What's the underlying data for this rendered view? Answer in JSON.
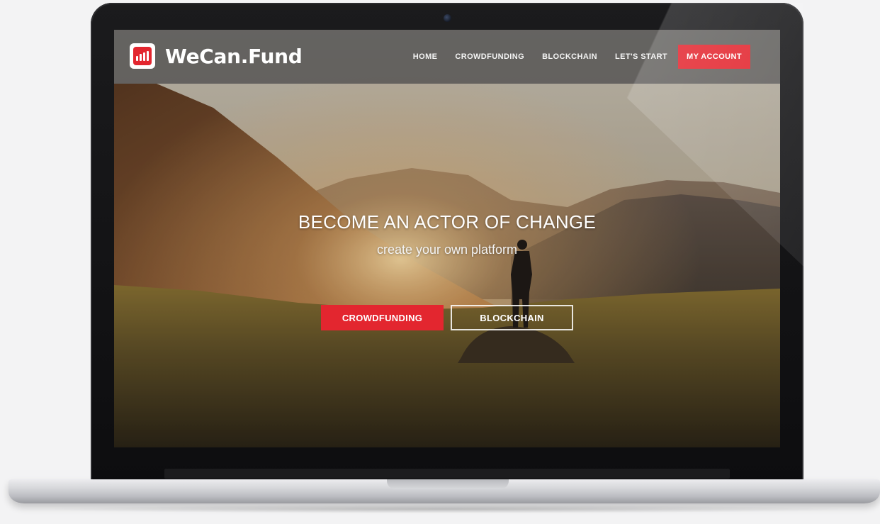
{
  "brand": {
    "name": "WeCan.Fund",
    "accent_color": "#e3262f",
    "logo_icon": "bar-chart-icon"
  },
  "nav": {
    "items": [
      {
        "label": "HOME"
      },
      {
        "label": "CROWDFUNDING"
      },
      {
        "label": "BLOCKCHAIN"
      },
      {
        "label": "LET'S START"
      }
    ],
    "account_label": "MY ACCOUNT"
  },
  "hero": {
    "title": "BECOME AN ACTOR OF CHANGE",
    "subtitle": "create your own platform",
    "primary_button": "CROWDFUNDING",
    "secondary_button": "BLOCKCHAIN"
  }
}
